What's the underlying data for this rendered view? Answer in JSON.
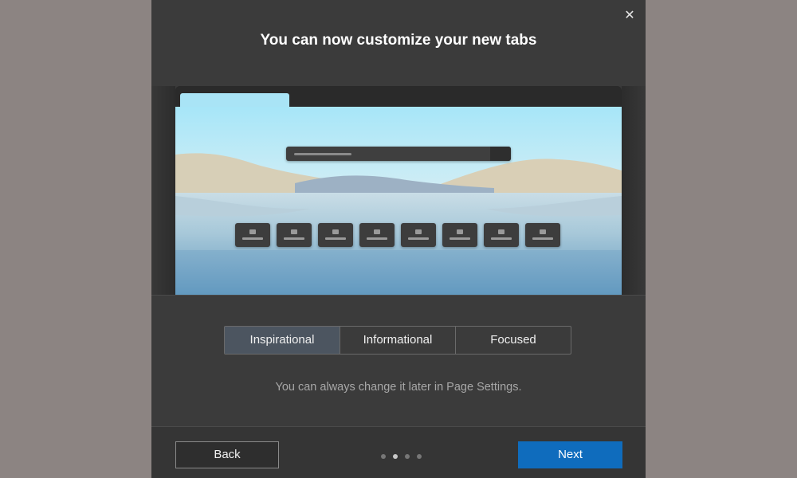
{
  "dialog": {
    "title": "You can now customize your new tabs",
    "close_icon": "close-icon"
  },
  "preview": {
    "quick_link_count": 8
  },
  "layout_options": {
    "selected": "Inspirational",
    "items": [
      {
        "label": "Inspirational",
        "selected": true
      },
      {
        "label": "Informational",
        "selected": false
      },
      {
        "label": "Focused",
        "selected": false
      }
    ]
  },
  "hint": "You can always change it later in Page Settings.",
  "footer": {
    "back_label": "Back",
    "next_label": "Next",
    "page_count": 4,
    "current_page": 2
  },
  "colors": {
    "accent": "#0f6cbd",
    "dialog_bg": "#3b3b3b",
    "overlay_bg": "#8c8482"
  }
}
